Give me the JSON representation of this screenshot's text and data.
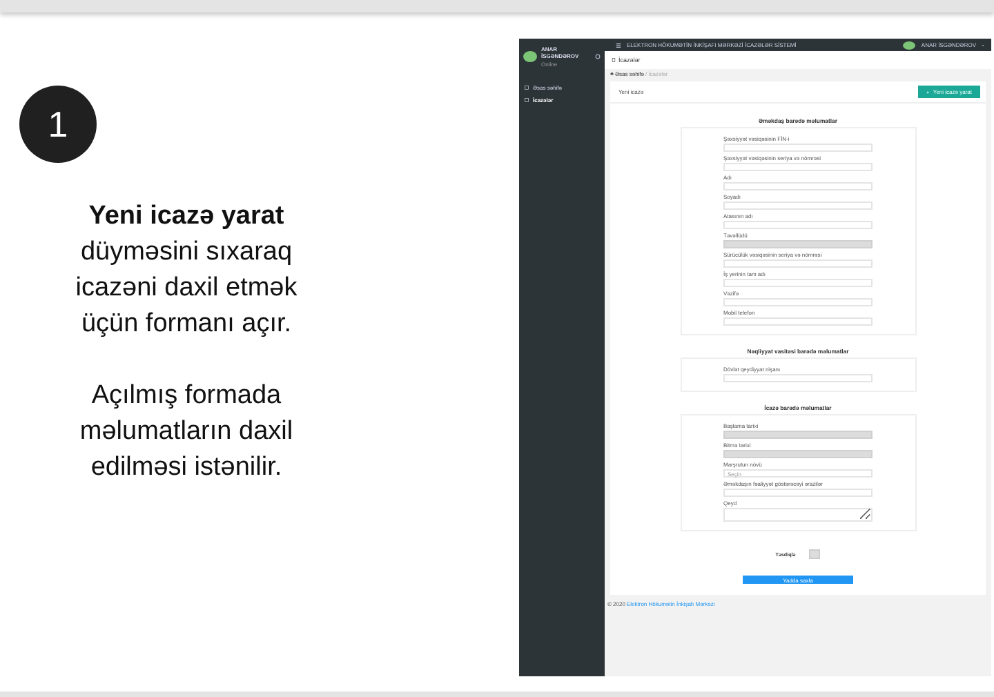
{
  "slide": {
    "step": "1",
    "caption": "**Yeni icazə yarat** düyməsini sıxaraq icazəni daxil etmək üçün formanı açır.",
    "note": "Açılmış formada məlumatların daxil edilməsi istənilir."
  },
  "app": {
    "topbar": {
      "title": "ELEKTRON HÖKUMƏTİN İNKİŞAFI MƏRKƏZİ İCAZƏLƏR SİSTEMİ",
      "user": "ANAR İSGƏNDƏROV"
    },
    "sidebar": {
      "user_name": "ANAR İSGƏNDƏROV",
      "user_status": "Online",
      "items": [
        {
          "label": "Əsas səhifə",
          "selected": false
        },
        {
          "label": "İcazələr",
          "selected": true
        }
      ]
    },
    "page_title": "İcazələr",
    "breadcrumb": [
      "Əsas səhifə",
      "İcazələr"
    ],
    "breadcrumb_separator": "/",
    "card_title": "Yeni icazə",
    "create_button": "Yeni icazə yarat",
    "sections": [
      {
        "title": "Əməkdaş barədə məlumatlar",
        "fields": [
          {
            "label": "Şəxsiyyət vəsiqəsinin FİN-i",
            "kind": "input",
            "disabled": false
          },
          {
            "label": "Şəxsiyyət vəsiqəsinin seriya və nömrəsi",
            "kind": "input",
            "disabled": false
          },
          {
            "label": "Adı",
            "kind": "input",
            "disabled": false
          },
          {
            "label": "Soyadı",
            "kind": "input",
            "disabled": false
          },
          {
            "label": "Atasının adı",
            "kind": "input",
            "disabled": false
          },
          {
            "label": "Təvəllüdü",
            "kind": "input",
            "disabled": true
          },
          {
            "label": "Sürücülük vəsiqəsinin seriya və nömrəsi",
            "kind": "input",
            "disabled": false
          },
          {
            "label": "İş yerinin tam adı",
            "kind": "input",
            "disabled": false
          },
          {
            "label": "Vəzifə",
            "kind": "input",
            "disabled": false
          },
          {
            "label": "Mobil telefon",
            "kind": "input",
            "disabled": false
          }
        ]
      },
      {
        "title": "Nəqliyyat vasitəsi barədə məlumatlar",
        "fields": [
          {
            "label": "Dövlət qeydiyyat nişanı",
            "kind": "input",
            "disabled": false
          }
        ]
      },
      {
        "title": "İcazə barədə məlumatlar",
        "fields": [
          {
            "label": "Başlama tarixi",
            "kind": "input",
            "disabled": true
          },
          {
            "label": "Bitmə tarixi",
            "kind": "input",
            "disabled": true
          },
          {
            "label": "Marşrutun növü",
            "kind": "select",
            "disabled": false,
            "placeholder": "Seçin"
          },
          {
            "label": "Əməkdaşın fəaliyyət göstərəcəyi ərazilər",
            "kind": "input",
            "disabled": false
          },
          {
            "label": "Qeyd",
            "kind": "textarea",
            "disabled": false
          }
        ]
      }
    ],
    "confirm": {
      "label": "Təsdiqlə",
      "checked": false
    },
    "submit_button": "Yadda saxla",
    "footer": {
      "year": "© 2020",
      "org": "Elektron Hökumətin İnkişafı Mərkəzi"
    }
  }
}
